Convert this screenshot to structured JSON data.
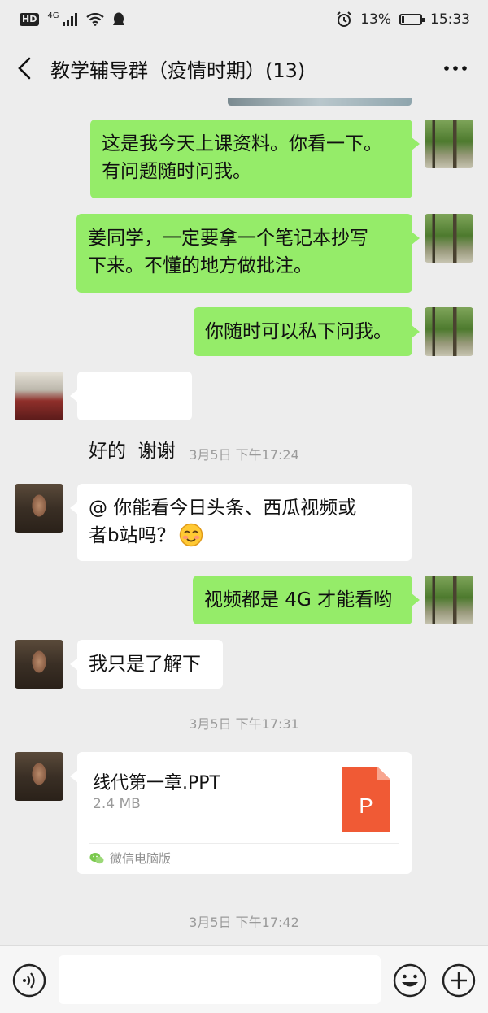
{
  "status_bar": {
    "hd": "HD",
    "network": "4G",
    "battery_percent": "13%",
    "time": "15:33",
    "battery_level": 0.13
  },
  "header": {
    "title": "教学辅导群（疫情时期）(13)"
  },
  "messages": [
    {
      "sender": "me",
      "text_line1": "这是我今天上课资料。你看一下。",
      "text_line2": "有问题随时问我。"
    },
    {
      "sender": "me",
      "text_line1": "姜同学，一定要拿一个笔记本抄写",
      "text_line2": "下来。不懂的地方做批注。"
    },
    {
      "sender": "me",
      "text": "你随时可以私下问我。"
    },
    {
      "sender": "other",
      "text": "好的  谢谢"
    },
    {
      "sender": "other",
      "text_line1": "@ 你能看今日头条、西瓜视频或",
      "text_line2": "者b站吗？"
    },
    {
      "sender": "me",
      "text": "视频都是 4G 才能看哟"
    },
    {
      "sender": "other",
      "text": "我只是了解下"
    }
  ],
  "timestamps": [
    "3月5日 下午17:24",
    "3月5日 下午17:31",
    "3月5日 下午17:42"
  ],
  "file_message": {
    "file_name": "线代第一章.PPT",
    "file_size": "2.4 MB",
    "file_type_letter": "P",
    "source": "微信电脑版",
    "icon_color": "#f05a35"
  },
  "input": {
    "value": "",
    "placeholder": ""
  },
  "colors": {
    "background": "#ededed",
    "my_bubble": "#95ec69",
    "other_bubble": "#ffffff"
  }
}
